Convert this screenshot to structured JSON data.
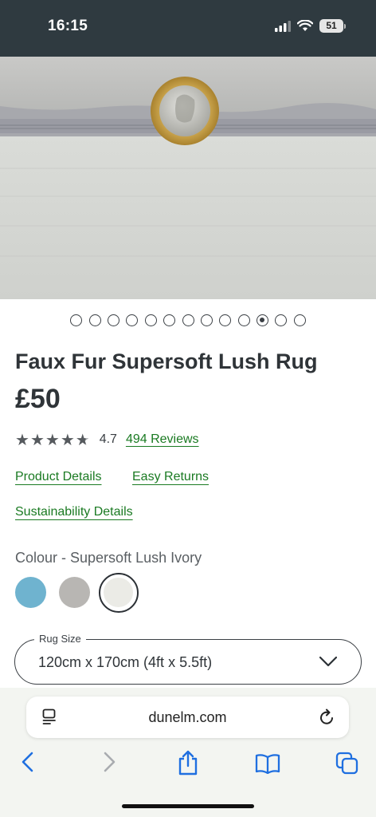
{
  "status_bar": {
    "time": "16:15",
    "battery": "51"
  },
  "gallery": {
    "slide_count": 13,
    "active_index": 10
  },
  "product": {
    "title": "Faux Fur Supersoft Lush Rug",
    "price": "£50",
    "rating_value": "4.7",
    "rating_stars": 4.7,
    "reviews_label": "494 Reviews"
  },
  "links": {
    "product_details": "Product Details",
    "easy_returns": "Easy Returns",
    "sustainability_details": "Sustainability Details"
  },
  "colour": {
    "label": "Colour - Supersoft Lush Ivory",
    "swatches": [
      {
        "name": "blue-swatch",
        "color": "#6fb3cf",
        "selected": false
      },
      {
        "name": "grey-swatch",
        "color": "#b8b6b3",
        "selected": false
      },
      {
        "name": "ivory-swatch",
        "color": "#ebebe6",
        "selected": true
      }
    ]
  },
  "rug_size": {
    "label": "Rug Size",
    "value": "120cm x 170cm (4ft x 5.5ft)"
  },
  "browser": {
    "url": "dunelm.com"
  },
  "colors": {
    "link_green": "#1a7a22",
    "status_bar": "#2f3a40",
    "ios_blue": "#1f6fe0"
  }
}
